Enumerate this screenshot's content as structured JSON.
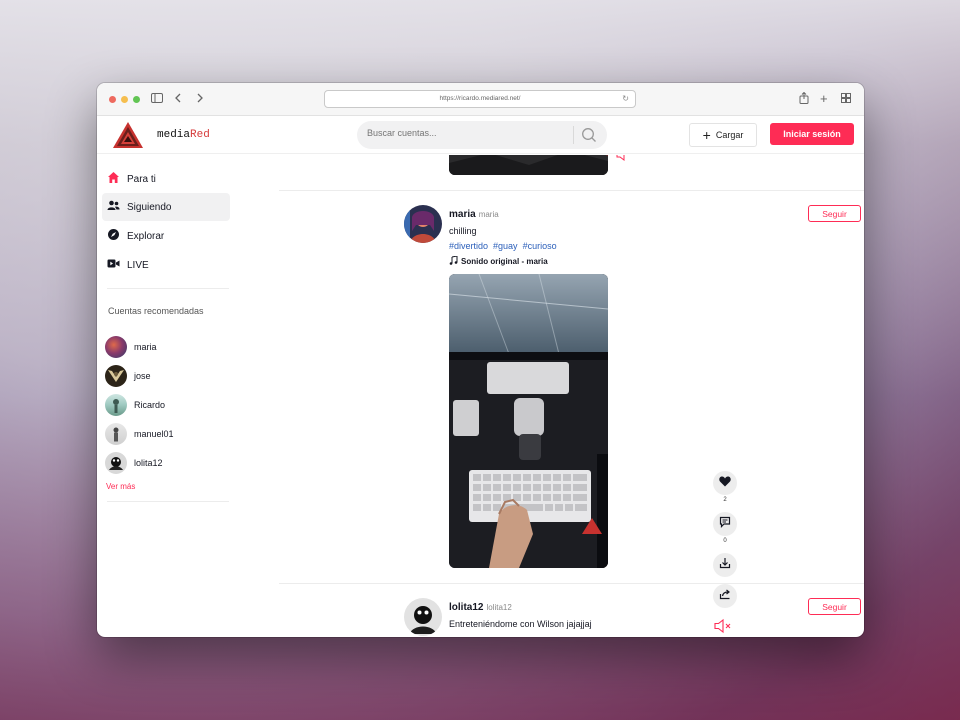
{
  "browser": {
    "url": "https://ricardo.mediared.net/"
  },
  "header": {
    "brand_prefix": "media",
    "brand_suffix": "Red",
    "search_placeholder": "Buscar cuentas...",
    "upload_label": "Cargar",
    "login_label": "Iniciar sesión"
  },
  "sidebar": {
    "nav": [
      {
        "label": "Para ti",
        "icon": "home-icon"
      },
      {
        "label": "Siguiendo",
        "icon": "users-icon"
      },
      {
        "label": "Explorar",
        "icon": "compass-icon"
      },
      {
        "label": "LIVE",
        "icon": "video-camera-icon"
      }
    ],
    "recommended_title": "Cuentas recomendadas",
    "accounts": [
      "maria",
      "jose",
      "Ricardo",
      "manuel01",
      "lolita12"
    ],
    "see_more": "Ver más"
  },
  "feed": {
    "posts": [
      {
        "username": "maria",
        "handle": "maria",
        "caption": "chilling",
        "tags": [
          "#divertido",
          "#guay",
          "#curioso"
        ],
        "sound": "Sonido original - maria",
        "follow_label": "Seguir",
        "likes": "2",
        "comments": "0"
      },
      {
        "username": "lolita12",
        "handle": "lolita12",
        "caption": "Entreteniéndome con Wilson jajajjaj",
        "follow_label": "Seguir"
      }
    ]
  },
  "colors": {
    "accent": "#fe2c55",
    "tag": "#2b5fba"
  }
}
